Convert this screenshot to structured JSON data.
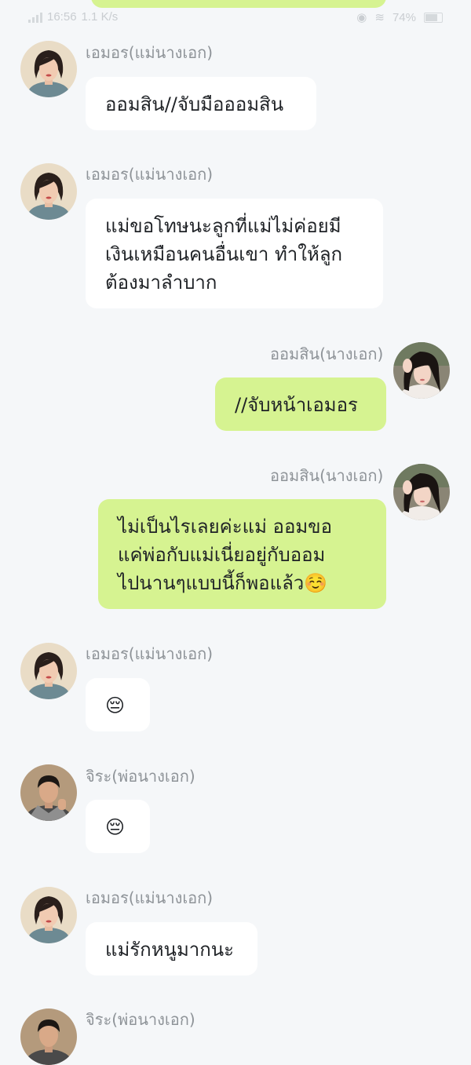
{
  "status_bar": {
    "time": "16:56",
    "speed": "1.1 K/s",
    "battery": "74%"
  },
  "messages": [
    {
      "id": "m1",
      "side": "left",
      "sender": "เอมอร(แม่นางเอก)",
      "avatar": "mother-avatar",
      "lines": [
        "ออมสิน//จับมือออมสิน"
      ]
    },
    {
      "id": "m2",
      "side": "left",
      "sender": "เอมอร(แม่นางเอก)",
      "avatar": "mother-avatar",
      "lines": [
        "แม่ขอโทษนะลูกที่แม่ไม่ค่อยมี",
        "เงินเหมือนคนอื่นเขา ทำให้ลูก",
        "ต้องมาลำบาก"
      ]
    },
    {
      "id": "m3",
      "side": "right",
      "sender": "ออมสิน(นางเอก)",
      "avatar": "heroine-avatar",
      "lines": [
        "//จับหน้าเอมอร"
      ]
    },
    {
      "id": "m4",
      "side": "right",
      "sender": "ออมสิน(นางเอก)",
      "avatar": "heroine-avatar",
      "lines": [
        "ไม่เป็นไรเลยค่ะแม่ ออมขอ",
        "แค่พ่อกับแม่เนี่ยอยู่กับออม",
        "ไปนานๆแบบนี้ก็พอแล้ว☺️"
      ]
    },
    {
      "id": "m5",
      "side": "left",
      "sender": "เอมอร(แม่นางเอก)",
      "avatar": "mother-avatar",
      "lines": [
        "😔"
      ]
    },
    {
      "id": "m6",
      "side": "left",
      "sender": "จิระ(พ่อนางเอก)",
      "avatar": "father-avatar",
      "lines": [
        "😔"
      ]
    },
    {
      "id": "m7",
      "side": "left",
      "sender": "เอมอร(แม่นางเอก)",
      "avatar": "mother-avatar",
      "lines": [
        "แม่รักหนูมากนะ"
      ]
    },
    {
      "id": "m8",
      "side": "left",
      "sender": "จิระ(พ่อนางเอก)",
      "avatar": "father-avatar",
      "lines": []
    }
  ],
  "colors": {
    "background": "#f5f7f9",
    "bubble_incoming": "#ffffff",
    "bubble_outgoing": "#d6f391",
    "sender_name": "#8e9398",
    "message_text": "#1f2226"
  }
}
